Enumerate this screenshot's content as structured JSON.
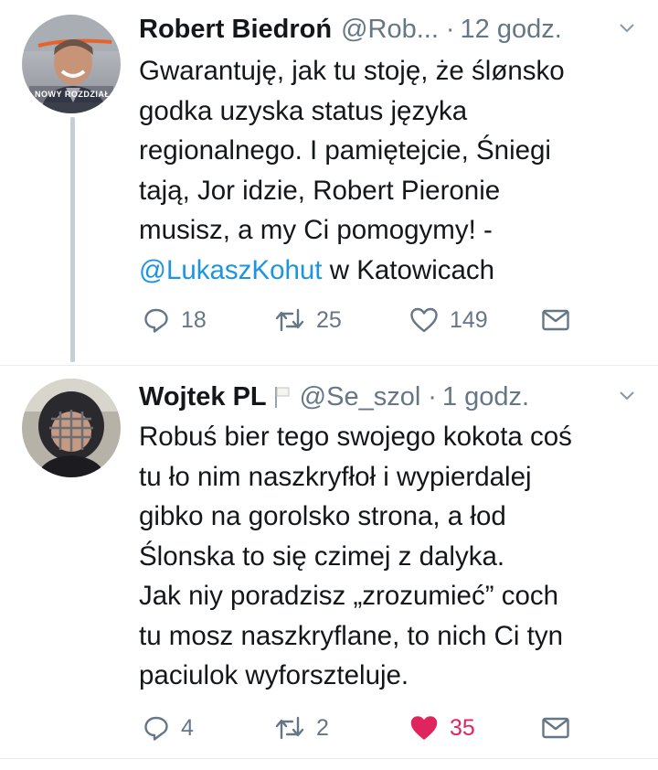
{
  "tweets": [
    {
      "author_name": "Robert Biedroń",
      "handle": "@Rob...",
      "dot": "·",
      "time": "12 godz.",
      "avatar_badge": "NOWY ROZDZIAŁ",
      "text_lines": [
        "Gwarantuję, jak tu stoję, że ślønsko",
        "godka uzyska status języka",
        "regionalnego. I pamiętejcie, Śniegi",
        "tają, Jor idzie, Robert Pieronie",
        "musisz, a my Ci pomogymy! -"
      ],
      "mention": "@LukaszKohut",
      "after_mention": " w Katowicach",
      "replies": "18",
      "retweets": "25",
      "likes": "149",
      "liked": false
    },
    {
      "author_name": "Wojtek PL",
      "handle": "@Se_szol",
      "dot": "·",
      "time": "1 godz.",
      "text_lines": [
        "Robuś bier tego swojego kokota coś",
        "tu ło nim naszkryfłoł i wypierdalej",
        "gibko na gorolsko strona, a łod",
        "Ślonska to się czimej z dalyka.",
        "Jak niy poradzisz „zrozumieć” coch",
        "tu mosz naszkryflane, to nich Ci tyn",
        "paciulok wyforszteluje."
      ],
      "replies": "4",
      "retweets": "2",
      "likes": "35",
      "liked": true
    }
  ],
  "colors": {
    "text": "#14171a",
    "secondary": "#657786",
    "link": "#1b95e0",
    "like": "#e0245e",
    "thread_line": "#c4cfd6"
  },
  "icons": {
    "reply": "reply-icon",
    "retweet": "retweet-icon",
    "like": "heart-icon",
    "dm": "envelope-icon",
    "more": "chevron-down-icon",
    "flag": "white-flag-icon"
  }
}
